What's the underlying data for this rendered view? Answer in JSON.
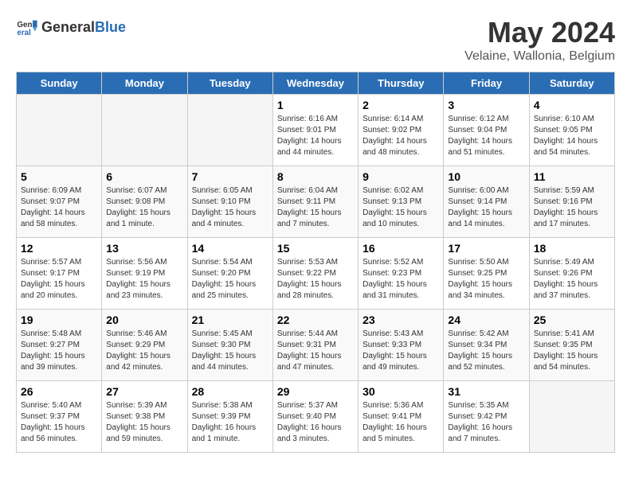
{
  "logo": {
    "general": "General",
    "blue": "Blue"
  },
  "header": {
    "month_year": "May 2024",
    "location": "Velaine, Wallonia, Belgium"
  },
  "weekdays": [
    "Sunday",
    "Monday",
    "Tuesday",
    "Wednesday",
    "Thursday",
    "Friday",
    "Saturday"
  ],
  "weeks": [
    [
      {
        "day": "",
        "empty": true
      },
      {
        "day": "",
        "empty": true
      },
      {
        "day": "",
        "empty": true
      },
      {
        "day": "1",
        "sunrise": "6:16 AM",
        "sunset": "9:01 PM",
        "daylight": "14 hours and 44 minutes."
      },
      {
        "day": "2",
        "sunrise": "6:14 AM",
        "sunset": "9:02 PM",
        "daylight": "14 hours and 48 minutes."
      },
      {
        "day": "3",
        "sunrise": "6:12 AM",
        "sunset": "9:04 PM",
        "daylight": "14 hours and 51 minutes."
      },
      {
        "day": "4",
        "sunrise": "6:10 AM",
        "sunset": "9:05 PM",
        "daylight": "14 hours and 54 minutes."
      }
    ],
    [
      {
        "day": "5",
        "sunrise": "6:09 AM",
        "sunset": "9:07 PM",
        "daylight": "14 hours and 58 minutes."
      },
      {
        "day": "6",
        "sunrise": "6:07 AM",
        "sunset": "9:08 PM",
        "daylight": "15 hours and 1 minute."
      },
      {
        "day": "7",
        "sunrise": "6:05 AM",
        "sunset": "9:10 PM",
        "daylight": "15 hours and 4 minutes."
      },
      {
        "day": "8",
        "sunrise": "6:04 AM",
        "sunset": "9:11 PM",
        "daylight": "15 hours and 7 minutes."
      },
      {
        "day": "9",
        "sunrise": "6:02 AM",
        "sunset": "9:13 PM",
        "daylight": "15 hours and 10 minutes."
      },
      {
        "day": "10",
        "sunrise": "6:00 AM",
        "sunset": "9:14 PM",
        "daylight": "15 hours and 14 minutes."
      },
      {
        "day": "11",
        "sunrise": "5:59 AM",
        "sunset": "9:16 PM",
        "daylight": "15 hours and 17 minutes."
      }
    ],
    [
      {
        "day": "12",
        "sunrise": "5:57 AM",
        "sunset": "9:17 PM",
        "daylight": "15 hours and 20 minutes."
      },
      {
        "day": "13",
        "sunrise": "5:56 AM",
        "sunset": "9:19 PM",
        "daylight": "15 hours and 23 minutes."
      },
      {
        "day": "14",
        "sunrise": "5:54 AM",
        "sunset": "9:20 PM",
        "daylight": "15 hours and 25 minutes."
      },
      {
        "day": "15",
        "sunrise": "5:53 AM",
        "sunset": "9:22 PM",
        "daylight": "15 hours and 28 minutes."
      },
      {
        "day": "16",
        "sunrise": "5:52 AM",
        "sunset": "9:23 PM",
        "daylight": "15 hours and 31 minutes."
      },
      {
        "day": "17",
        "sunrise": "5:50 AM",
        "sunset": "9:25 PM",
        "daylight": "15 hours and 34 minutes."
      },
      {
        "day": "18",
        "sunrise": "5:49 AM",
        "sunset": "9:26 PM",
        "daylight": "15 hours and 37 minutes."
      }
    ],
    [
      {
        "day": "19",
        "sunrise": "5:48 AM",
        "sunset": "9:27 PM",
        "daylight": "15 hours and 39 minutes."
      },
      {
        "day": "20",
        "sunrise": "5:46 AM",
        "sunset": "9:29 PM",
        "daylight": "15 hours and 42 minutes."
      },
      {
        "day": "21",
        "sunrise": "5:45 AM",
        "sunset": "9:30 PM",
        "daylight": "15 hours and 44 minutes."
      },
      {
        "day": "22",
        "sunrise": "5:44 AM",
        "sunset": "9:31 PM",
        "daylight": "15 hours and 47 minutes."
      },
      {
        "day": "23",
        "sunrise": "5:43 AM",
        "sunset": "9:33 PM",
        "daylight": "15 hours and 49 minutes."
      },
      {
        "day": "24",
        "sunrise": "5:42 AM",
        "sunset": "9:34 PM",
        "daylight": "15 hours and 52 minutes."
      },
      {
        "day": "25",
        "sunrise": "5:41 AM",
        "sunset": "9:35 PM",
        "daylight": "15 hours and 54 minutes."
      }
    ],
    [
      {
        "day": "26",
        "sunrise": "5:40 AM",
        "sunset": "9:37 PM",
        "daylight": "15 hours and 56 minutes."
      },
      {
        "day": "27",
        "sunrise": "5:39 AM",
        "sunset": "9:38 PM",
        "daylight": "15 hours and 59 minutes."
      },
      {
        "day": "28",
        "sunrise": "5:38 AM",
        "sunset": "9:39 PM",
        "daylight": "16 hours and 1 minute."
      },
      {
        "day": "29",
        "sunrise": "5:37 AM",
        "sunset": "9:40 PM",
        "daylight": "16 hours and 3 minutes."
      },
      {
        "day": "30",
        "sunrise": "5:36 AM",
        "sunset": "9:41 PM",
        "daylight": "16 hours and 5 minutes."
      },
      {
        "day": "31",
        "sunrise": "5:35 AM",
        "sunset": "9:42 PM",
        "daylight": "16 hours and 7 minutes."
      },
      {
        "day": "",
        "empty": true
      }
    ]
  ]
}
